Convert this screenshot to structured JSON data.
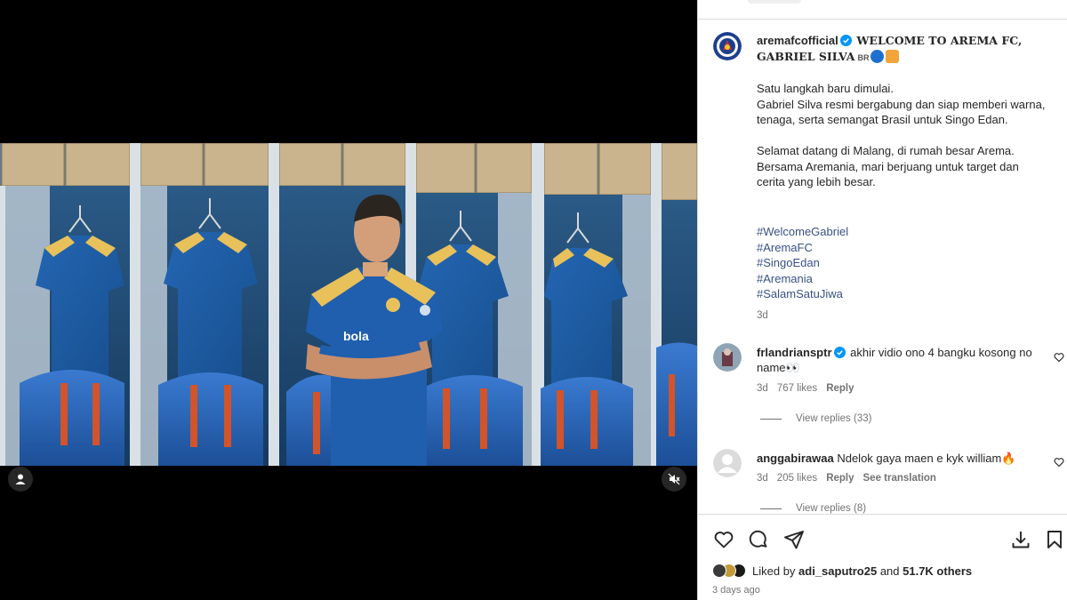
{
  "post": {
    "author": "aremafcofficial",
    "title": "WELCOME TO AREMA FC, GABRIEL SILVA",
    "title_flag": "BR",
    "caption_paragraphs": [
      "Satu langkah baru dimulai.\nGabriel Silva resmi bergabung dan siap memberi warna, tenaga, serta semangat Brasil untuk Singo Edan.",
      "Selamat datang di Malang, di rumah besar Arema. Bersama Aremania, mari berjuang untuk target dan cerita yang lebih besar."
    ],
    "hashtags": [
      "#WelcomeGabriel",
      "#AremaFC",
      "#SingoEdan",
      "#Aremania",
      "#SalamSatuJiwa"
    ],
    "caption_age": "3d"
  },
  "comments": [
    {
      "user": "frlandriansptr",
      "verified": true,
      "text": "akhir vidio ono 4 bangku kosong no name👀",
      "age": "3d",
      "likes": "767 likes",
      "reply": "Reply",
      "view_replies": "View replies (33)"
    },
    {
      "user": "anggabirawaa",
      "verified": false,
      "text": "Ndelok gaya maen e kyk william🔥",
      "age": "3d",
      "likes": "205 likes",
      "reply": "Reply",
      "translation": "See translation",
      "view_replies": "View replies (8)"
    }
  ],
  "footer": {
    "liked_by_prefix": "Liked by ",
    "liked_by_user": "adi_saputro25",
    "liked_by_mid": " and ",
    "liked_by_count": "51.7K others",
    "posted": "3 days ago"
  },
  "colors": {
    "jersey_blue": "#1e5aa8",
    "jersey_yellow": "#e8c15a",
    "locker_wall": "#1f4a73",
    "link_blue": "#385185"
  },
  "icons": {
    "like": "heart-icon",
    "comment": "comment-icon",
    "share": "paper-plane-icon",
    "download": "download-icon",
    "save": "bookmark-icon",
    "user_tag": "user-icon",
    "mute": "speaker-muted-icon"
  }
}
